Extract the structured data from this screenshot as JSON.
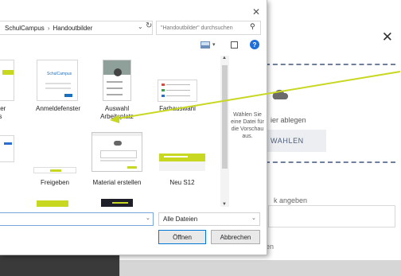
{
  "background_page": {
    "drop_text": "ier ablegen",
    "choose_button": "WAHLEN",
    "link_label": "k angeben",
    "toggle_label": "en",
    "close_icon": "close-icon"
  },
  "dialog": {
    "breadcrumb": [
      "SchulCampus",
      "Handoutbilder"
    ],
    "search_placeholder": "\"Handoutbilder\" durchsuchen",
    "files": [
      {
        "label": "ster\nus"
      },
      {
        "label": "Anmeldefenster"
      },
      {
        "label": "Auswahl\nArbeitsplatz"
      },
      {
        "label": "Farbauswahl"
      },
      {
        "label": ""
      },
      {
        "label": "Freigeben"
      },
      {
        "label": "Material erstellen"
      },
      {
        "label": "Neu S12"
      }
    ],
    "preview_text": "Wählen Sie eine Datei für die Vorschau aus.",
    "file_type": "Alle Dateien",
    "open_button": "Öffnen",
    "cancel_button": "Abbrechen",
    "accent_color": "#0078d7"
  },
  "arrow_color": "#c8d820"
}
